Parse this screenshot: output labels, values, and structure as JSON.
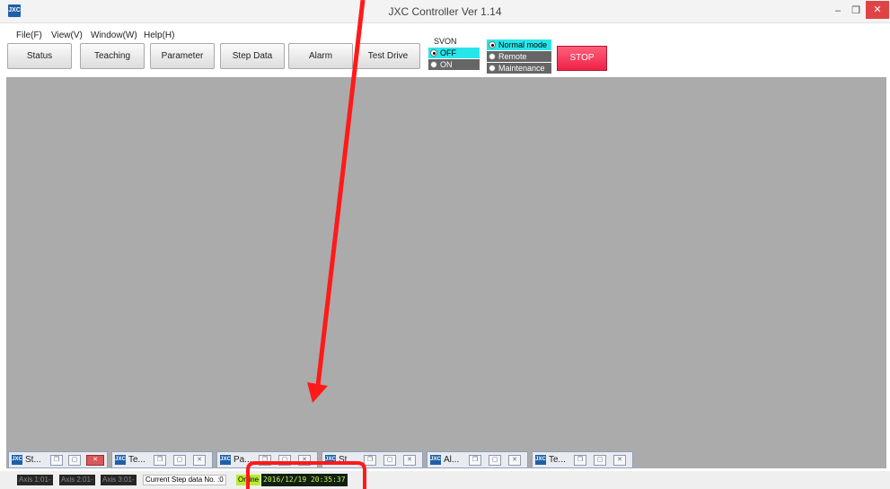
{
  "window": {
    "title": "JXC Controller Ver 1.14",
    "icon_text": "JXC",
    "minimize_glyph": "–",
    "maximize_glyph": "❐",
    "close_glyph": "✕"
  },
  "menu": [
    {
      "label": "File(F)"
    },
    {
      "label": "View(V)"
    },
    {
      "label": "Window(W)"
    },
    {
      "label": "Help(H)"
    }
  ],
  "toolbar": {
    "buttons": [
      {
        "label": "Status"
      },
      {
        "label": "Teaching"
      },
      {
        "label": "Parameter"
      },
      {
        "label": "Step Data"
      },
      {
        "label": "Alarm"
      },
      {
        "label": "Test Drive"
      }
    ],
    "svon_label": "SVON",
    "svon_options": [
      {
        "label": "OFF",
        "selected": true
      },
      {
        "label": "ON",
        "selected": false
      }
    ],
    "mode_options": [
      {
        "label": "Normal mode",
        "selected": true
      },
      {
        "label": "Remote",
        "selected": false
      },
      {
        "label": "Maintenance",
        "selected": false
      }
    ],
    "stop_label": "STOP"
  },
  "minimized_windows": [
    {
      "title": "St..."
    },
    {
      "title": "Te..."
    },
    {
      "title": "Pa..."
    },
    {
      "title": "St..."
    },
    {
      "title": "Al..."
    },
    {
      "title": "Te..."
    }
  ],
  "statusbar": {
    "axes": [
      {
        "label": "Axis 1:01-"
      },
      {
        "label": "Axis 2:01-"
      },
      {
        "label": "Axis 3:01-"
      }
    ],
    "step_text": "Current Step data No. :0",
    "online_text": "Online",
    "datetime": "2016/12/19 20:35:37"
  },
  "colors": {
    "desktop": "#ababab",
    "annotation": "#ff1a1a",
    "stop": "#ee2146",
    "selected_option": "#27e6ea"
  }
}
